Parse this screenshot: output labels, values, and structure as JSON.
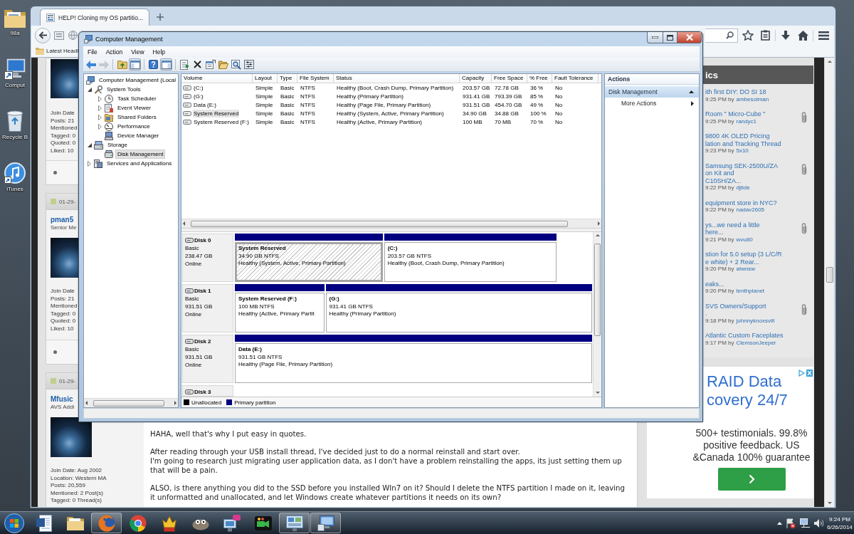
{
  "desktop": {
    "icons": [
      {
        "label": "98a",
        "kind": "folder"
      },
      {
        "label": "Comput",
        "kind": "computer"
      },
      {
        "label": "Recycle B",
        "kind": "bin"
      },
      {
        "label": "iTunes",
        "kind": "music"
      }
    ]
  },
  "browser": {
    "tabs": [
      {
        "title": "HELP! Cloning my OS partitio...",
        "selected": true
      }
    ],
    "nav_tools": [
      [
        {
          "kind": "star"
        },
        {
          "kind": "clipboard"
        }
      ],
      [
        {
          "kind": "download"
        },
        {
          "kind": "home"
        }
      ],
      [
        {
          "kind": "menu"
        }
      ]
    ],
    "bookmarks": [
      {
        "label": "Latest Headli"
      }
    ],
    "posts": [
      {
        "online": false,
        "info": [
          "Join Date",
          "Posts: 21",
          "Mentioned",
          "Tagged: 0",
          "Quoted: 0",
          "Liked: 10"
        ]
      },
      {
        "date": "01-29-",
        "username": "pman5",
        "rank": "Senior Me",
        "online": false,
        "info": [
          "Join Date",
          "Posts: 21",
          "Mentioned",
          "Tagged: 0",
          "Quoted: 0",
          "Liked: 10"
        ]
      },
      {
        "date": "01-29-",
        "username": "Mfusic",
        "rank": "AVS Addi",
        "info": [
          "Join Date: Aug 2002",
          "Location: Western MA",
          "Posts: 20,559",
          "Mentioned: 2 Post(s)",
          "Tagged: 0 Thread(s)"
        ],
        "paragraphs": [
          [
            "HAHA, well that's why I put easy in quotes."
          ],
          [
            "After reading through your USB install thread, I've decided just to do a normal reinstall and start over.",
            "I'm going to research just migrating user application data, as I don't have a problem reinstalling the apps, its just setting them up that will be a pain."
          ],
          [
            "ALSO, is there anything you did to the SSD before you installed WIn7 on it? Should I delete the NTFS partition I made on it, leaving it unformatted and unallocated, and let Windows create whatever partitions it needs on its own?"
          ]
        ]
      }
    ],
    "sidebar": {
      "heading": "ics",
      "topics": [
        {
          "title_lines": [
            "ith first DIY: DO SI 18"
          ],
          "time": "9:25 PM by",
          "author": "ambesolman",
          "attachment": false
        },
        {
          "title_lines": [
            "Room \" Micro-Cube \""
          ],
          "time": "9:25 PM by",
          "author": "randyc1",
          "attachment": true
        },
        {
          "title_lines": [
            "9800 4K OLED Pricing",
            "lation and Tracking Thread"
          ],
          "time": "9:23 PM by",
          "author": "5x10",
          "attachment": false
        },
        {
          "title_lines": [
            "Samsung SEK-2500U/ZA",
            "on Kit and",
            "C10SH/ZA..."
          ],
          "time": "9:22 PM by",
          "author": "djtide",
          "attachment": true
        },
        {
          "title_lines": [
            "equipment store in NYC?"
          ],
          "time": "9:22 PM by",
          "author": "nadav2605",
          "attachment": false
        },
        {
          "title_lines": [
            "ys...we need a little",
            "here..."
          ],
          "time": "9:21 PM by",
          "author": "wvu80",
          "attachment": true
        },
        {
          "title_lines": [
            "stion for 5.0 setup (3 L/C/R",
            "e white) + 2 Rear..."
          ],
          "time": "9:20 PM by",
          "author": "atwnsw",
          "attachment": false
        },
        {
          "title_lines": [
            "eaks..."
          ],
          "time": "9:20 PM by",
          "author": "tenthplanet",
          "attachment": false
        },
        {
          "title_lines": [
            "SVS Owners/Support",
            "."
          ],
          "time": "9:18 PM by",
          "author": "johnnyknoxsvill",
          "attachment": true
        },
        {
          "title_lines": [
            "Atlantic Custom Faceplates"
          ],
          "time": "9:17 PM by",
          "author": "ClemsonJeeper",
          "attachment": false
        }
      ]
    },
    "ad": {
      "headline": [
        "RAID Data",
        "covery 24/7"
      ],
      "lines": [
        "500+ testimonials. 99.8%",
        "positive feedback. US",
        "&Canada 100% guarantee"
      ]
    }
  },
  "computer_management": {
    "title": "Computer Management",
    "menu": [
      "File",
      "Action",
      "View",
      "Help"
    ],
    "toolbar": [
      [
        {
          "kind": "back",
          "disabled": false,
          "pressed": false
        },
        {
          "kind": "forward",
          "disabled": true,
          "pressed": false
        }
      ],
      [
        {
          "kind": "up",
          "disabled": false,
          "pressed": false
        },
        {
          "kind": "tree-pane",
          "disabled": false,
          "pressed": true
        }
      ],
      [
        {
          "kind": "help",
          "disabled": false,
          "pressed": false
        },
        {
          "kind": "action-pane",
          "disabled": false,
          "pressed": true
        }
      ],
      [
        {
          "kind": "export",
          "disabled": false,
          "pressed": false
        },
        {
          "kind": "delete",
          "disabled": false,
          "pressed": false
        },
        {
          "kind": "properties",
          "disabled": false,
          "pressed": false
        },
        {
          "kind": "open",
          "disabled": false,
          "pressed": false
        },
        {
          "kind": "find",
          "disabled": false,
          "pressed": false
        },
        {
          "kind": "options",
          "disabled": false,
          "pressed": false
        }
      ]
    ],
    "tree": [
      {
        "label": "Computer Management (Local",
        "kind": "computer",
        "selected": false,
        "children": [
          {
            "label": "System Tools",
            "kind": "tools",
            "expanded": true,
            "selected": false,
            "children": [
              {
                "label": "Task Scheduler",
                "kind": "clock",
                "expanded": false,
                "selected": false
              },
              {
                "label": "Event Viewer",
                "kind": "log",
                "expanded": false,
                "selected": false
              },
              {
                "label": "Shared Folders",
                "kind": "share",
                "expanded": false,
                "selected": false
              },
              {
                "label": "Performance",
                "kind": "gauge",
                "expanded": false,
                "selected": false
              },
              {
                "label": "Device Manager",
                "kind": "devices",
                "selected": false
              }
            ]
          },
          {
            "label": "Storage",
            "kind": "storage",
            "expanded": true,
            "selected": false,
            "children": [
              {
                "label": "Disk Management",
                "kind": "disk",
                "selected": true
              }
            ]
          },
          {
            "label": "Services and Applications",
            "kind": "services",
            "expanded": false,
            "selected": false
          }
        ]
      }
    ],
    "columns": [
      "Volume",
      "Layout",
      "Type",
      "File System",
      "Status",
      "Capacity",
      "Free Space",
      "% Free",
      "Fault Tolerance"
    ],
    "volumes": [
      {
        "cells": [
          "(C:)",
          "Simple",
          "Basic",
          "NTFS",
          "Healthy (Boot, Crash Dump, Primary Partition)",
          "203.57 GB",
          "72.78 GB",
          "36 %",
          "No"
        ],
        "selected": false
      },
      {
        "cells": [
          "(G:)",
          "Simple",
          "Basic",
          "NTFS",
          "Healthy (Primary Partition)",
          "931.41 GB",
          "793.39 GB",
          "85 %",
          "No"
        ],
        "selected": false
      },
      {
        "cells": [
          "Data (E:)",
          "Simple",
          "Basic",
          "NTFS",
          "Healthy (Page File, Primary Partition)",
          "931.51 GB",
          "454.70 GB",
          "49 %",
          "No"
        ],
        "selected": false
      },
      {
        "cells": [
          "System Reserved",
          "Simple",
          "Basic",
          "NTFS",
          "Healthy (System, Active, Primary Partition)",
          "34.90 GB",
          "34.88 GB",
          "100 %",
          "No"
        ],
        "selected": true
      },
      {
        "cells": [
          "System Reserved (F:)",
          "Simple",
          "Basic",
          "NTFS",
          "Healthy (Active, Primary Partition)",
          "100 MB",
          "70 MB",
          "70 %",
          "No"
        ],
        "selected": false
      }
    ],
    "disks": [
      {
        "name": "Disk 0",
        "type": "Basic",
        "size": "238.47 GB",
        "status": "Online",
        "partitions": [
          {
            "label": "System Reserved",
            "size": "34.90 GB NTFS",
            "status": "Healthy (System, Active, Primary Partition)",
            "selected": true
          },
          {
            "label": "(C:)",
            "size": "203.57 GB NTFS",
            "status": "Healthy (Boot, Crash Dump, Primary Partition)",
            "selected": false
          }
        ]
      },
      {
        "name": "Disk 1",
        "type": "Basic",
        "size": "931.51 GB",
        "status": "Online",
        "partitions": [
          {
            "label": "System Reserved (F:)",
            "size": "100 MB NTFS",
            "status": "Healthy (Active, Primary Partit",
            "selected": false
          },
          {
            "label": "(G:)",
            "size": "931.41 GB NTFS",
            "status": "Healthy (Primary Partition)",
            "selected": false
          }
        ]
      },
      {
        "name": "Disk 2",
        "type": "Basic",
        "size": "931.51 GB",
        "status": "Online",
        "partitions": [
          {
            "label": "Data (E:)",
            "size": "931.51 GB NTFS",
            "status": "Healthy (Page File, Primary Partition)",
            "selected": false
          }
        ]
      },
      {
        "name": "Disk 3"
      }
    ],
    "legend": [
      {
        "label": "Unallocated",
        "color": "#000000"
      },
      {
        "label": "Primary partition",
        "color": "#000080"
      }
    ],
    "actions": {
      "title": "Actions",
      "items": [
        {
          "label": "Disk Management",
          "kind": "section"
        },
        {
          "label": "More Actions",
          "kind": "submenu"
        }
      ]
    }
  },
  "taskbar": {
    "items": [
      {
        "kind": "document",
        "open": false
      },
      {
        "kind": "folder",
        "open": false
      },
      {
        "kind": "globe",
        "open": true
      },
      {
        "kind": "wheel",
        "open": false
      },
      {
        "kind": "figure",
        "open": false
      },
      {
        "kind": "creature",
        "open": false
      },
      {
        "kind": "network",
        "open": false
      },
      {
        "kind": "camera",
        "open": false
      },
      {
        "kind": "screen",
        "open": true
      },
      {
        "kind": "console",
        "open": true
      }
    ],
    "tray": [
      {
        "kind": "show-hidden"
      },
      {
        "kind": "flag"
      },
      {
        "kind": "network"
      },
      {
        "kind": "speaker"
      }
    ],
    "time": "9:24 PM",
    "date": "6/26/2014"
  }
}
